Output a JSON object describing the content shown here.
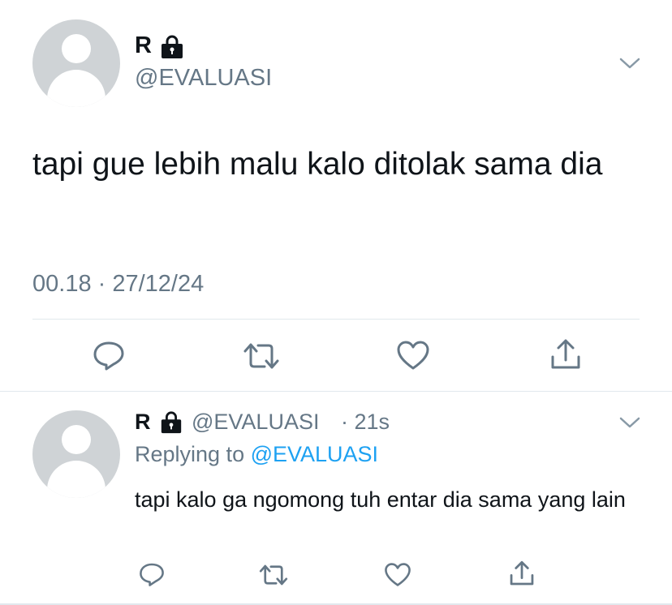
{
  "main_tweet": {
    "name": "R",
    "handle": "@EVALUASI",
    "text": "tapi gue lebih malu kalo ditolak sama dia",
    "timestamp": "00.18 · 27/12/24",
    "actions": [
      "reply-icon",
      "retweet-icon",
      "like-icon",
      "share-icon"
    ]
  },
  "reply": {
    "name": "R",
    "handle": "@EVALUASI",
    "time": "· 21s",
    "replying_prefix": "Replying to ",
    "replying_mention": "@EVALUASI",
    "text": "tapi kalo ga ngomong tuh entar dia sama yang lain"
  },
  "colors": {
    "text": "#0f1419",
    "secondary": "#657786",
    "link": "#1da1f2",
    "divider": "#e1e8ed",
    "avatar": "#cfd3d6"
  }
}
